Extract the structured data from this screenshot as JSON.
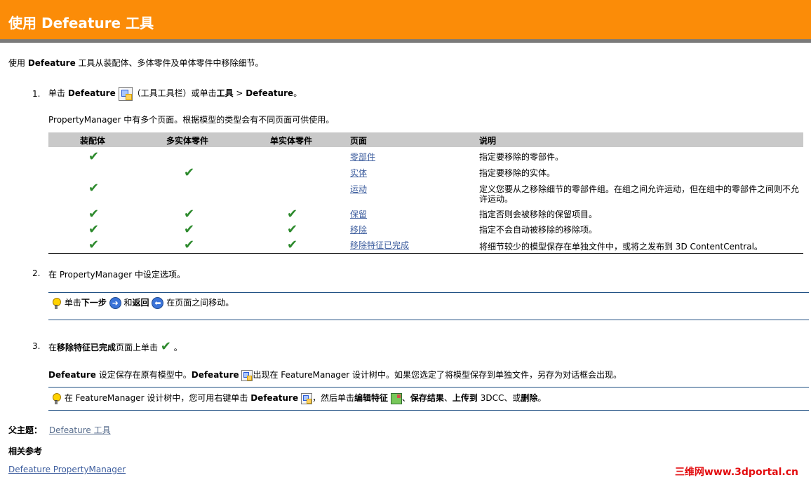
{
  "title": "使用  Defeature 工具",
  "intro": {
    "pre": "使用 ",
    "bold": "Defeature",
    "post": " 工具从装配体、多体零件及单体零件中移除细节。"
  },
  "step1": {
    "number": "1.",
    "pre": "单击 ",
    "bold1": "Defeature",
    "mid": "（工具工具栏）或单击",
    "bold2": "工具",
    "mid2": " > ",
    "bold3": "Defeature",
    "post": "。",
    "tool_icon": "defeature-icon",
    "desc": "PropertyManager 中有多个页面。根据模型的类型会有不同页面可供使用。"
  },
  "table": {
    "headers": [
      "装配体",
      "多实体零件",
      "单实体零件",
      "页面",
      "说明"
    ],
    "rows": [
      {
        "assembly": true,
        "multi": false,
        "single": false,
        "page": "零部件",
        "desc": "指定要移除的零部件。"
      },
      {
        "assembly": false,
        "multi": true,
        "single": false,
        "page": "实体",
        "desc": "指定要移除的实体。"
      },
      {
        "assembly": true,
        "multi": false,
        "single": false,
        "page": "运动",
        "desc": "定义您要从之移除细节的零部件组。在组之间允许运动，但在组中的零部件之间则不允",
        "desc2": "许运动。"
      },
      {
        "assembly": true,
        "multi": true,
        "single": true,
        "page": "保留",
        "desc": "指定否则会被移除的保留项目。"
      },
      {
        "assembly": true,
        "multi": true,
        "single": true,
        "page": "移除",
        "desc": "指定不会自动被移除的移除项。"
      },
      {
        "assembly": true,
        "multi": true,
        "single": true,
        "page": "移除特征已完成",
        "desc": "将细节较少的模型保存在单独文件中，或将之发布到  3D ContentCentral。"
      }
    ],
    "check_glyph": "✔"
  },
  "step2": {
    "number": "2.",
    "text": "在  PropertyManager 中设定选项。"
  },
  "tip1": {
    "pre": "单击",
    "bold1": "下一步",
    "mid": "和",
    "bold2": "返回",
    "post": "在页面之间移动。",
    "next_glyph": "➜",
    "back_glyph": "⬅"
  },
  "step3": {
    "number": "3.",
    "pre": "在",
    "bold": "移除特征已完成",
    "post": "页面上单击",
    "end": "。"
  },
  "step3_desc": {
    "bold1": "Defeature",
    "mid1": " 设定保存在原有模型中。",
    "bold2": "Defeature",
    "post": "出现在  FeatureManager 设计树中。如果您选定了将模型保存到单独文件，另存为对话框会出现。"
  },
  "tip2": {
    "pre": "在  FeatureManager 设计树中，您可用右键单击 ",
    "bold1": "Defeature",
    "mid": "，然后单击",
    "bold2": "编辑特征",
    "sep": "、",
    "bold3": "保存结果",
    "sep2": "、",
    "bold4": "上传到",
    "post": "  3DCC、或",
    "bold5": "删除",
    "end": "。"
  },
  "parent": {
    "label": "父主题：",
    "link": "Defeature 工具"
  },
  "related": {
    "heading": "相关参考",
    "link": "Defeature PropertyManager"
  },
  "watermark": "三维网www.3dportal.cn"
}
